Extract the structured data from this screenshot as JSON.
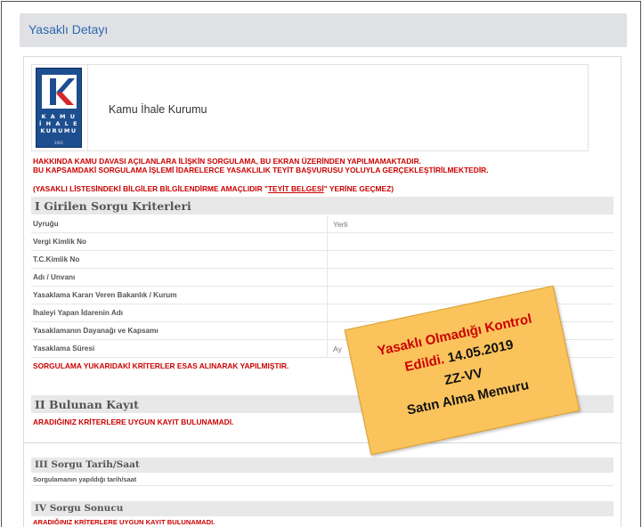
{
  "header": {
    "title": "Yasaklı Detayı"
  },
  "organization": {
    "logo_lines": [
      "K A M U",
      "İ H A L E",
      "KURUMU"
    ],
    "logo_year": "2002",
    "name": "Kamu İhale Kurumu"
  },
  "warnings": {
    "line1": "HAKKINDA KAMU DAVASI AÇILANLARA İLİŞKİN SORGULAMA, BU EKRAN ÜZERİNDEN YAPILMAMAKTADIR.",
    "line2": "BU KAPSAMDAKİ SORGULAMA İŞLEMİ İDARELERCE YASAKLILIK TEYİT BAŞVURUSU YOLUYLA GERÇEKLEŞTİRİLMEKTEDİR.",
    "line3_pre": "(YASAKLI LİSTESİNDEKİ BİLGİLER BİLGİLENDİRME AMAÇLIDIR \"",
    "line3_link": "TEYİT BELGESİ",
    "line3_post": "\" YERİNE GEÇMEZ)"
  },
  "section1": {
    "title": "I Girilen Sorgu Kriterleri",
    "rows": [
      {
        "label": "Uyruğu",
        "value": "Yerli"
      },
      {
        "label": "Vergi Kimlik No",
        "value": ""
      },
      {
        "label": "T.C.Kimlik No",
        "value": ""
      },
      {
        "label": "Adı / Unvanı",
        "value": ""
      },
      {
        "label": "Yasaklama Kararı Veren Bakanlık / Kurum",
        "value": ""
      },
      {
        "label": "İhaleyi Yapan İdarenin Adı",
        "value": ""
      },
      {
        "label": "Yasaklamanın Dayanağı ve Kapsamı",
        "value": ""
      },
      {
        "label": "Yasaklama Süresi",
        "value": "Ay"
      }
    ],
    "note": "SORGULAMA YUKARIDAKİ KRİTERLER ESAS ALINARAK YAPILMIŞTIR."
  },
  "section2": {
    "title": "II Bulunan Kayıt",
    "message": "ARADIĞINIZ KRİTERLERE UYGUN KAYIT BULUNAMADI."
  },
  "section3": {
    "title": "III Sorgu Tarih/Saat",
    "row_label": "Sorgulamanın yapıldığı tarih/saat"
  },
  "section4": {
    "title": "IV Sorgu Sonucu",
    "message": "ARADIĞINIZ KRİTERLERE UYGUN KAYIT BULUNAMADI."
  },
  "stamp": {
    "line1": "Yasaklı Olmadığı Kontrol",
    "line2_red": "Edildi.",
    "line2_date": " 14.05.2019",
    "line3": "ZZ-VV",
    "line4": "Satın Alma Memuru"
  },
  "colors": {
    "header_bg": "#dfe1e4",
    "title_blue": "#2f67b0",
    "warning_red": "#cc0000",
    "logo_blue": "#1d4e8f",
    "stamp_bg": "#fbc35c"
  }
}
